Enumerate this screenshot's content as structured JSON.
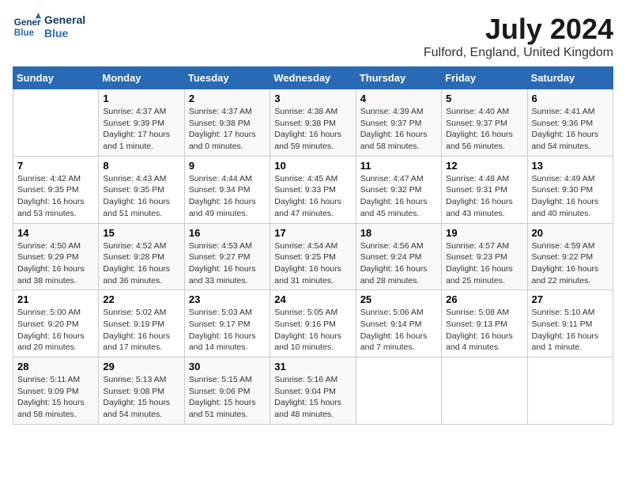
{
  "header": {
    "logo_line1": "General",
    "logo_line2": "Blue",
    "title": "July 2024",
    "subtitle": "Fulford, England, United Kingdom"
  },
  "days_of_week": [
    "Sunday",
    "Monday",
    "Tuesday",
    "Wednesday",
    "Thursday",
    "Friday",
    "Saturday"
  ],
  "weeks": [
    [
      {
        "day": "",
        "info": ""
      },
      {
        "day": "1",
        "info": "Sunrise: 4:37 AM\nSunset: 9:39 PM\nDaylight: 17 hours\nand 1 minute."
      },
      {
        "day": "2",
        "info": "Sunrise: 4:37 AM\nSunset: 9:38 PM\nDaylight: 17 hours\nand 0 minutes."
      },
      {
        "day": "3",
        "info": "Sunrise: 4:38 AM\nSunset: 9:38 PM\nDaylight: 16 hours\nand 59 minutes."
      },
      {
        "day": "4",
        "info": "Sunrise: 4:39 AM\nSunset: 9:37 PM\nDaylight: 16 hours\nand 58 minutes."
      },
      {
        "day": "5",
        "info": "Sunrise: 4:40 AM\nSunset: 9:37 PM\nDaylight: 16 hours\nand 56 minutes."
      },
      {
        "day": "6",
        "info": "Sunrise: 4:41 AM\nSunset: 9:36 PM\nDaylight: 16 hours\nand 54 minutes."
      }
    ],
    [
      {
        "day": "7",
        "info": "Sunrise: 4:42 AM\nSunset: 9:35 PM\nDaylight: 16 hours\nand 53 minutes."
      },
      {
        "day": "8",
        "info": "Sunrise: 4:43 AM\nSunset: 9:35 PM\nDaylight: 16 hours\nand 51 minutes."
      },
      {
        "day": "9",
        "info": "Sunrise: 4:44 AM\nSunset: 9:34 PM\nDaylight: 16 hours\nand 49 minutes."
      },
      {
        "day": "10",
        "info": "Sunrise: 4:45 AM\nSunset: 9:33 PM\nDaylight: 16 hours\nand 47 minutes."
      },
      {
        "day": "11",
        "info": "Sunrise: 4:47 AM\nSunset: 9:32 PM\nDaylight: 16 hours\nand 45 minutes."
      },
      {
        "day": "12",
        "info": "Sunrise: 4:48 AM\nSunset: 9:31 PM\nDaylight: 16 hours\nand 43 minutes."
      },
      {
        "day": "13",
        "info": "Sunrise: 4:49 AM\nSunset: 9:30 PM\nDaylight: 16 hours\nand 40 minutes."
      }
    ],
    [
      {
        "day": "14",
        "info": "Sunrise: 4:50 AM\nSunset: 9:29 PM\nDaylight: 16 hours\nand 38 minutes."
      },
      {
        "day": "15",
        "info": "Sunrise: 4:52 AM\nSunset: 9:28 PM\nDaylight: 16 hours\nand 36 minutes."
      },
      {
        "day": "16",
        "info": "Sunrise: 4:53 AM\nSunset: 9:27 PM\nDaylight: 16 hours\nand 33 minutes."
      },
      {
        "day": "17",
        "info": "Sunrise: 4:54 AM\nSunset: 9:25 PM\nDaylight: 16 hours\nand 31 minutes."
      },
      {
        "day": "18",
        "info": "Sunrise: 4:56 AM\nSunset: 9:24 PM\nDaylight: 16 hours\nand 28 minutes."
      },
      {
        "day": "19",
        "info": "Sunrise: 4:57 AM\nSunset: 9:23 PM\nDaylight: 16 hours\nand 25 minutes."
      },
      {
        "day": "20",
        "info": "Sunrise: 4:59 AM\nSunset: 9:22 PM\nDaylight: 16 hours\nand 22 minutes."
      }
    ],
    [
      {
        "day": "21",
        "info": "Sunrise: 5:00 AM\nSunset: 9:20 PM\nDaylight: 16 hours\nand 20 minutes."
      },
      {
        "day": "22",
        "info": "Sunrise: 5:02 AM\nSunset: 9:19 PM\nDaylight: 16 hours\nand 17 minutes."
      },
      {
        "day": "23",
        "info": "Sunrise: 5:03 AM\nSunset: 9:17 PM\nDaylight: 16 hours\nand 14 minutes."
      },
      {
        "day": "24",
        "info": "Sunrise: 5:05 AM\nSunset: 9:16 PM\nDaylight: 16 hours\nand 10 minutes."
      },
      {
        "day": "25",
        "info": "Sunrise: 5:06 AM\nSunset: 9:14 PM\nDaylight: 16 hours\nand 7 minutes."
      },
      {
        "day": "26",
        "info": "Sunrise: 5:08 AM\nSunset: 9:13 PM\nDaylight: 16 hours\nand 4 minutes."
      },
      {
        "day": "27",
        "info": "Sunrise: 5:10 AM\nSunset: 9:11 PM\nDaylight: 16 hours\nand 1 minute."
      }
    ],
    [
      {
        "day": "28",
        "info": "Sunrise: 5:11 AM\nSunset: 9:09 PM\nDaylight: 15 hours\nand 58 minutes."
      },
      {
        "day": "29",
        "info": "Sunrise: 5:13 AM\nSunset: 9:08 PM\nDaylight: 15 hours\nand 54 minutes."
      },
      {
        "day": "30",
        "info": "Sunrise: 5:15 AM\nSunset: 9:06 PM\nDaylight: 15 hours\nand 51 minutes."
      },
      {
        "day": "31",
        "info": "Sunrise: 5:16 AM\nSunset: 9:04 PM\nDaylight: 15 hours\nand 48 minutes."
      },
      {
        "day": "",
        "info": ""
      },
      {
        "day": "",
        "info": ""
      },
      {
        "day": "",
        "info": ""
      }
    ]
  ]
}
